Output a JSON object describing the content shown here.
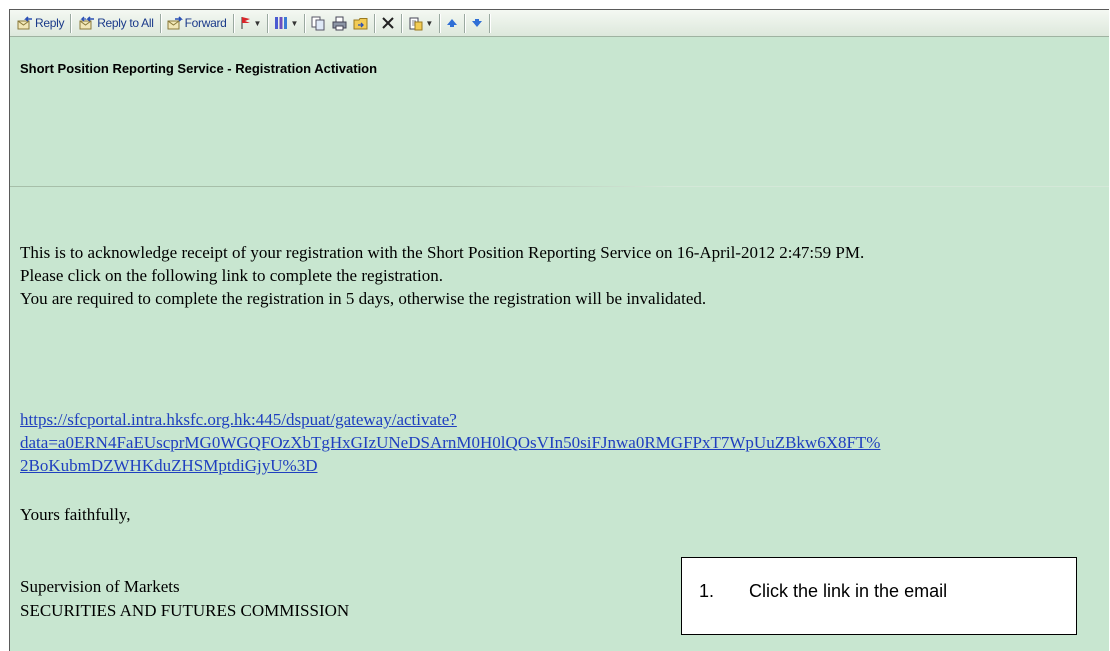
{
  "toolbar": {
    "reply_label": "Reply",
    "reply_all_label": "Reply to All",
    "forward_label": "Forward"
  },
  "email": {
    "subject": "Short Position Reporting Service - Registration Activation",
    "body_lines": [
      "This is to acknowledge receipt of your registration with the Short Position Reporting Service on 16-April-2012 2:47:59 PM.",
      "Please click on the following link to complete the registration.",
      "You are required to complete the registration in 5 days, otherwise the registration will be invalidated."
    ],
    "link_lines": [
      "https://sfcportal.intra.hksfc.org.hk:445/dspuat/gateway/activate?",
      "data=a0ERN4FaEUscprMG0WGQFOzXbTgHxGIzUNeDSArnM0H0lQOsVIn50siFJnwa0RMGFPxT7WpUuZBkw6X8FT%",
      "2BoKubmDZWHKduZHSMptdiGjyU%3D"
    ],
    "closing": "Yours faithfully,",
    "signature_line1": "Supervision of Markets",
    "signature_line2": "SECURITIES AND FUTURES COMMISSION"
  },
  "callout": {
    "number": "1.",
    "text": "Click the link in the email"
  }
}
